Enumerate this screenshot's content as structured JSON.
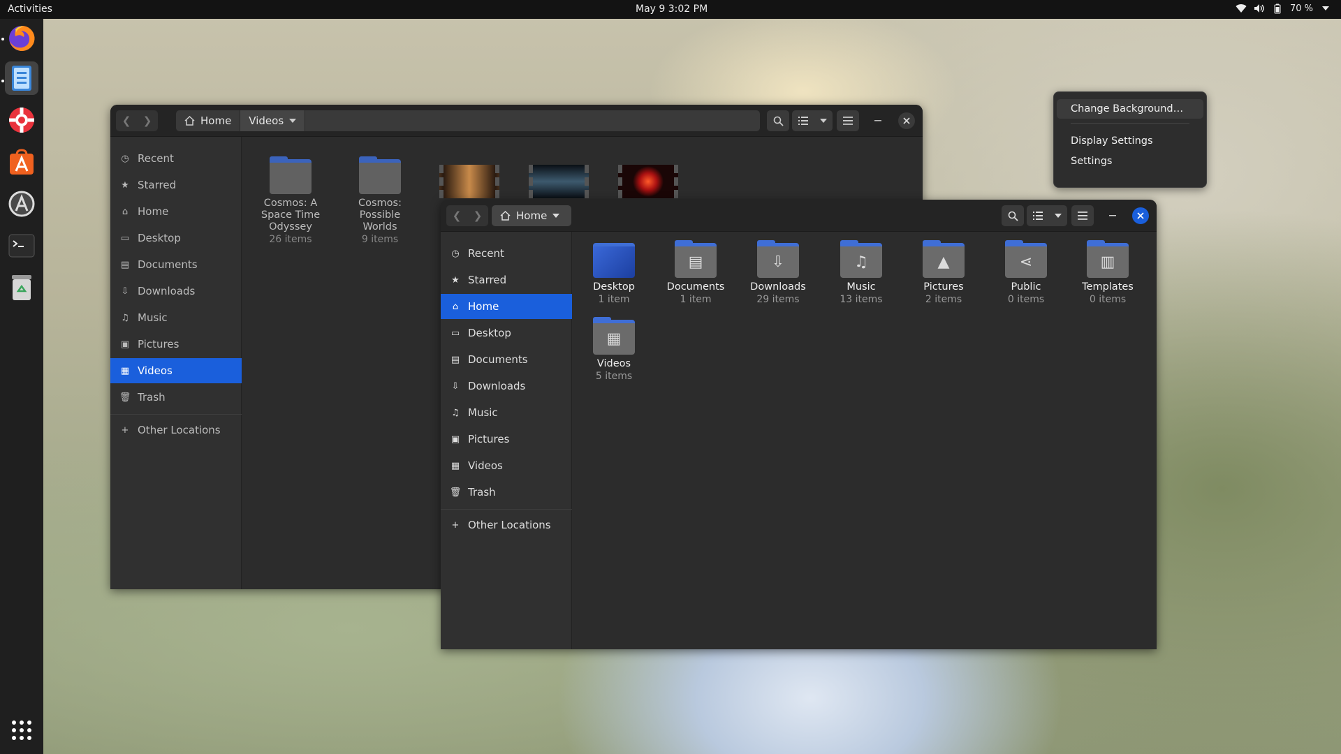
{
  "topbar": {
    "activities": "Activities",
    "clock": "May 9  3:02 PM",
    "battery": "70 %",
    "icons": [
      "wifi-icon",
      "volume-icon",
      "battery-icon",
      "chevron-down-icon"
    ]
  },
  "dock": {
    "apps": [
      {
        "name": "firefox-icon",
        "running": true
      },
      {
        "name": "files-icon",
        "running": true,
        "active": true
      },
      {
        "name": "help-icon",
        "running": false
      },
      {
        "name": "software-center-icon",
        "running": false
      },
      {
        "name": "updater-icon",
        "running": false
      },
      {
        "name": "terminal-icon",
        "running": false
      },
      {
        "name": "trash-icon",
        "running": false
      },
      {
        "name": "show-apps-icon",
        "running": false
      }
    ]
  },
  "colors": {
    "accent": "#1a5fdc",
    "folder_tab": "#3f6ed6",
    "folder_body": "#6b6b6b",
    "window_bg": "#2c2c2c",
    "sidebar_bg": "#303030"
  },
  "back_window": {
    "path": [
      "Home",
      "Videos"
    ],
    "sidebar": [
      {
        "label": "Recent",
        "icon": "clock-icon"
      },
      {
        "label": "Starred",
        "icon": "star-icon"
      },
      {
        "label": "Home",
        "icon": "home-icon"
      },
      {
        "label": "Desktop",
        "icon": "desktop-icon"
      },
      {
        "label": "Documents",
        "icon": "document-icon"
      },
      {
        "label": "Downloads",
        "icon": "download-icon"
      },
      {
        "label": "Music",
        "icon": "music-icon"
      },
      {
        "label": "Pictures",
        "icon": "picture-icon"
      },
      {
        "label": "Videos",
        "icon": "video-icon",
        "selected": true
      },
      {
        "label": "Trash",
        "icon": "trash-icon"
      }
    ],
    "other_locations": "Other Locations",
    "items": [
      {
        "name": "Cosmos: A Space Time Odyssey",
        "count": "26 items"
      },
      {
        "name": "Cosmos: Possible Worlds",
        "count": "9 items"
      }
    ]
  },
  "front_window": {
    "path": [
      "Home"
    ],
    "sidebar": [
      {
        "label": "Recent",
        "icon": "clock-icon"
      },
      {
        "label": "Starred",
        "icon": "star-icon"
      },
      {
        "label": "Home",
        "icon": "home-icon",
        "selected": true
      },
      {
        "label": "Desktop",
        "icon": "desktop-icon"
      },
      {
        "label": "Documents",
        "icon": "document-icon"
      },
      {
        "label": "Downloads",
        "icon": "download-icon"
      },
      {
        "label": "Music",
        "icon": "music-icon"
      },
      {
        "label": "Pictures",
        "icon": "picture-icon"
      },
      {
        "label": "Videos",
        "icon": "video-icon"
      },
      {
        "label": "Trash",
        "icon": "trash-icon"
      }
    ],
    "other_locations": "Other Locations",
    "items": [
      {
        "name": "Desktop",
        "count": "1 item",
        "icon": "desktop-folder-icon"
      },
      {
        "name": "Documents",
        "count": "1 item",
        "icon": "documents-folder-icon"
      },
      {
        "name": "Downloads",
        "count": "29 items",
        "icon": "downloads-folder-icon"
      },
      {
        "name": "Music",
        "count": "13 items",
        "icon": "music-folder-icon"
      },
      {
        "name": "Pictures",
        "count": "2 items",
        "icon": "pictures-folder-icon"
      },
      {
        "name": "Public",
        "count": "0 items",
        "icon": "public-folder-icon"
      },
      {
        "name": "Templates",
        "count": "0 items",
        "icon": "templates-folder-icon"
      },
      {
        "name": "Videos",
        "count": "5 items",
        "icon": "videos-folder-icon"
      }
    ]
  },
  "context_menu": {
    "items": [
      "Change Background…",
      "Display Settings",
      "Settings"
    ]
  }
}
